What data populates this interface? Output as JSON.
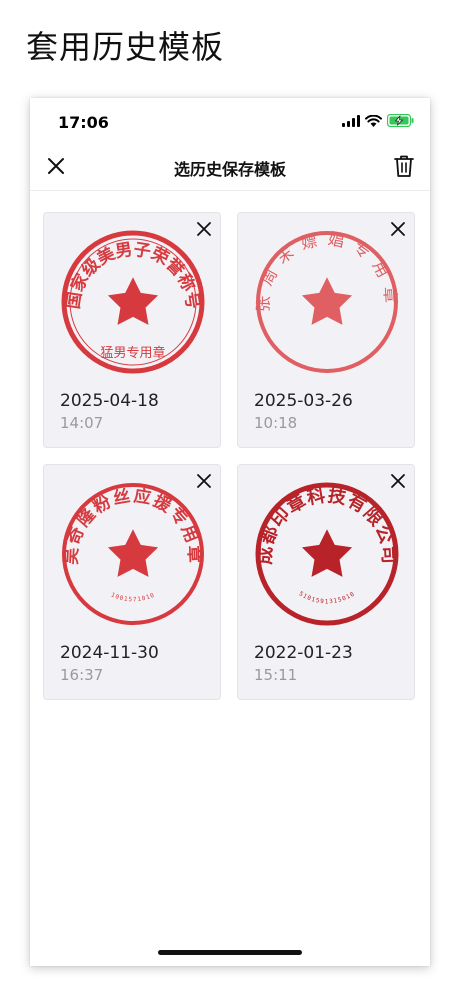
{
  "caption": "套用历史模板",
  "status_bar": {
    "time": "17:06"
  },
  "nav": {
    "title": "选历史保存模板"
  },
  "colors": {
    "stamp_red": "#d63a3f",
    "stamp_red_faded": "#df5f62",
    "stamp_dark_red": "#b82329",
    "battery_green": "#35c759"
  },
  "templates": [
    {
      "date": "2025-04-18",
      "time": "14:07",
      "stamp": {
        "ring_text": "国家级美男子荣誉称号",
        "bottom_text": "猛男专用章",
        "number": ""
      }
    },
    {
      "date": "2025-03-26",
      "time": "10:18",
      "stamp": {
        "ring_text": "张周末嫖娼专用章",
        "bottom_text": "",
        "number": ""
      }
    },
    {
      "date": "2024-11-30",
      "time": "16:37",
      "stamp": {
        "ring_text": "吴奇隆粉丝应援专用章",
        "bottom_text": "",
        "number": "1001571010"
      }
    },
    {
      "date": "2022-01-23",
      "time": "15:11",
      "stamp": {
        "ring_text": "成都印章科技有限公司",
        "bottom_text": "",
        "number": "5101591315010"
      }
    }
  ]
}
